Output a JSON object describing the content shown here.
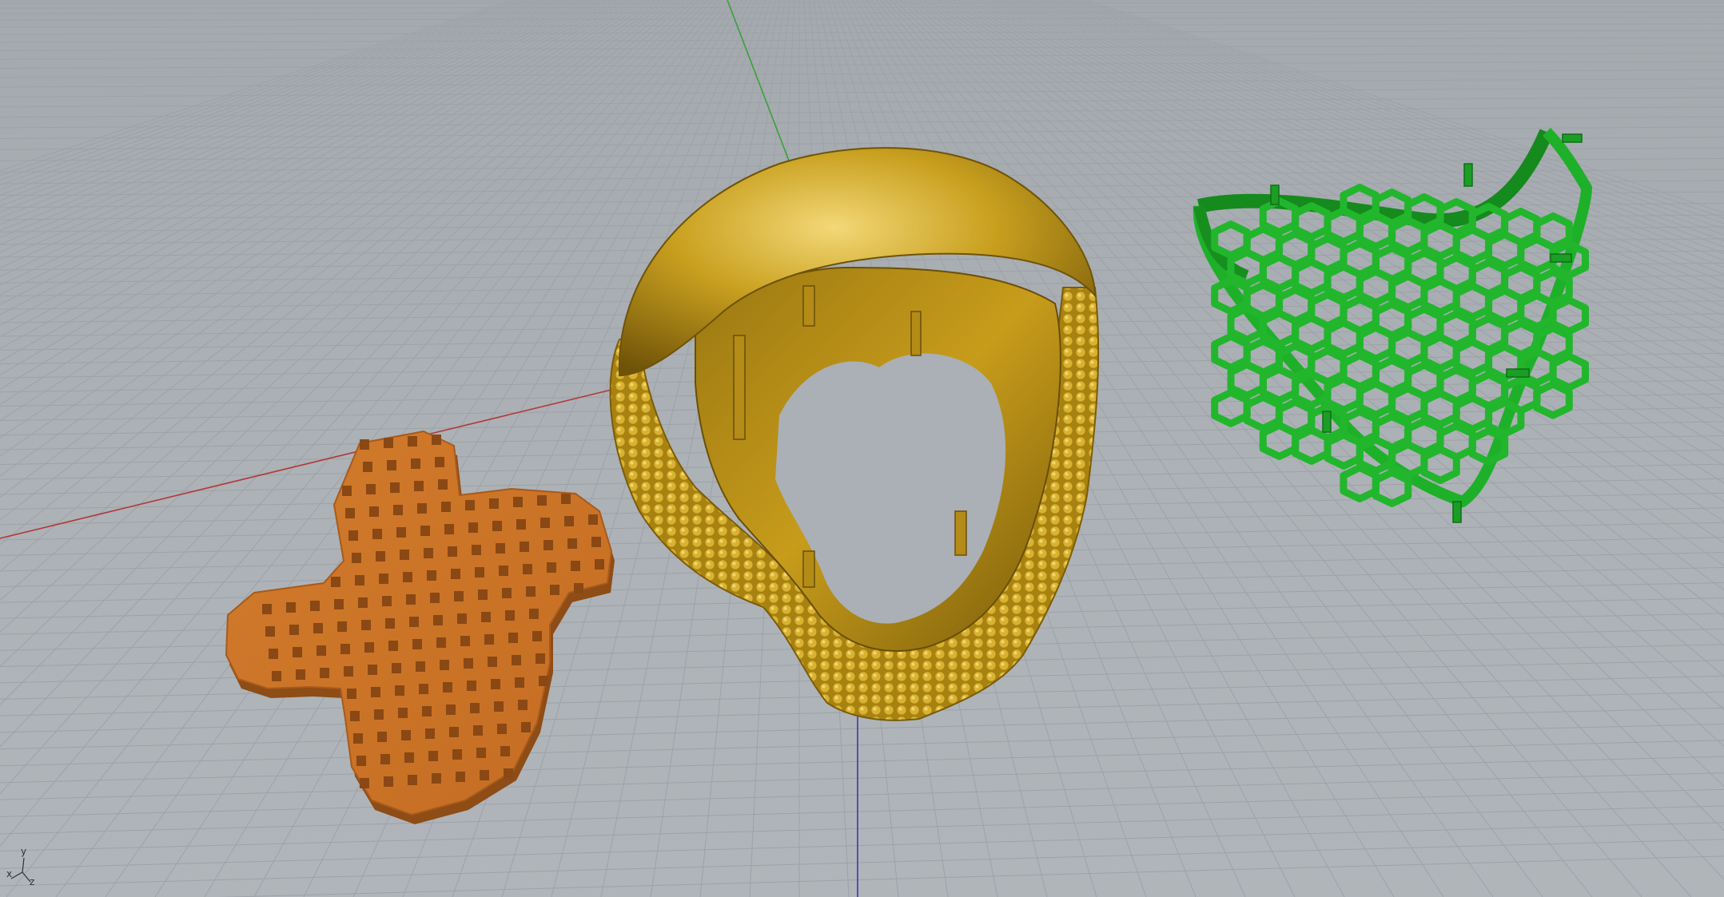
{
  "viewport": {
    "view": "perspective",
    "grid": true,
    "background_color": "#aab0b5",
    "grid_color": "#9aa0a6",
    "axis_colors": {
      "x": "#b33a3a",
      "y": "#3aa03a",
      "z": "#3a3aa8"
    }
  },
  "axis_triad": {
    "x_label": "x",
    "y_label": "y",
    "z_label": "z"
  },
  "objects": [
    {
      "name": "perforated-clover-plate",
      "color": "#c8732a"
    },
    {
      "name": "textured-ring",
      "color": "#c9a01f"
    },
    {
      "name": "hexagon-lattice-shell",
      "color": "#1fb02a"
    }
  ]
}
